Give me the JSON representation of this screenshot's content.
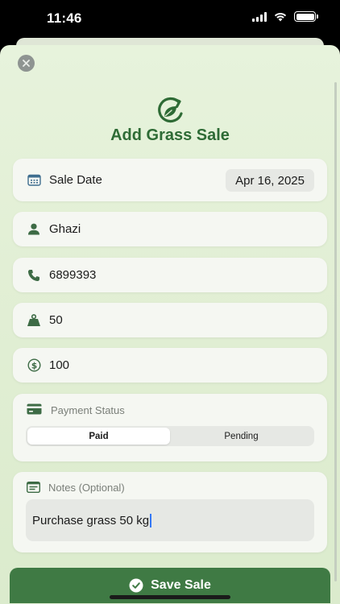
{
  "status_bar": {
    "time": "11:46"
  },
  "form": {
    "title": "Add Grass Sale",
    "sale_date": {
      "label": "Sale Date",
      "value": "Apr 16, 2025"
    },
    "customer_name": "Ghazi",
    "phone": "6899393",
    "quantity": "50",
    "amount": "100",
    "payment_status": {
      "label": "Payment Status",
      "options": [
        "Paid",
        "Pending"
      ],
      "selected": "Paid"
    },
    "notes": {
      "label": "Notes (Optional)",
      "value": "Purchase grass 50 kg"
    }
  },
  "actions": {
    "save_label": "Save Sale"
  },
  "colors": {
    "accent": "#2e6b35",
    "button": "#3f7a44",
    "background": "#e2efd5"
  }
}
